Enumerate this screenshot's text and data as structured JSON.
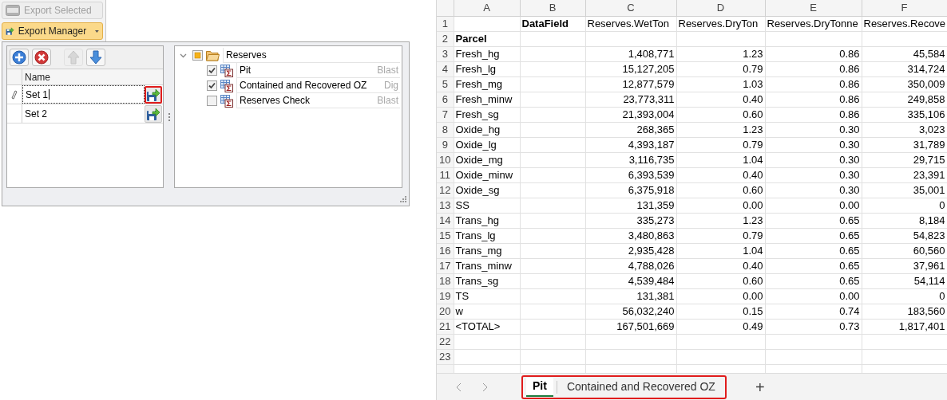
{
  "ribbon": {
    "buttons": [
      {
        "label": "Export Selected",
        "disabled": true,
        "kind": "xlsx",
        "dropdown": false
      },
      {
        "label": "Export Manager",
        "disabled": false,
        "kind": "export",
        "dropdown": true
      }
    ]
  },
  "sets_grid": {
    "toolbar": [
      {
        "kind": "add",
        "disabled": false
      },
      {
        "kind": "delete",
        "disabled": false
      },
      {
        "kind": "up",
        "disabled": true
      },
      {
        "kind": "down",
        "disabled": false
      }
    ],
    "column": "Name",
    "rows": [
      {
        "name": "Set 1",
        "editing": true,
        "highlighted": true
      },
      {
        "name": "Set 2",
        "editing": false,
        "highlighted": false
      }
    ]
  },
  "tree": {
    "label": "Reserves",
    "expanded": true,
    "indeterminate": true,
    "children": [
      {
        "label": "Pit",
        "checked": true,
        "type": "Blast"
      },
      {
        "label": "Contained and Recovered OZ",
        "checked": true,
        "type": "Dig"
      },
      {
        "label": "Reserves Check",
        "checked": false,
        "type": "Blast"
      }
    ]
  },
  "sheet": {
    "columns": [
      "A",
      "B",
      "C",
      "D",
      "E",
      "F"
    ],
    "rows": [
      {
        "number": "1",
        "kind": "header",
        "cells": [
          "",
          "DataField",
          "Reserves.WetTon",
          "Reserves.DryTon",
          "Reserves.DryTonne",
          "Reserves.Recove"
        ]
      },
      {
        "number": "2",
        "kind": "header",
        "cells": [
          "Parcel"
        ]
      },
      {
        "number": "3",
        "kind": "data",
        "cells": [
          "Fresh_hg",
          "",
          "1,408,771",
          "1.23",
          "0.86",
          "45,584"
        ]
      },
      {
        "number": "4",
        "kind": "data",
        "cells": [
          "Fresh_lg",
          "",
          "15,127,205",
          "0.79",
          "0.86",
          "314,724"
        ]
      },
      {
        "number": "5",
        "kind": "data",
        "cells": [
          "Fresh_mg",
          "",
          "12,877,579",
          "1.03",
          "0.86",
          "350,009"
        ]
      },
      {
        "number": "6",
        "kind": "data",
        "cells": [
          "Fresh_minw",
          "",
          "23,773,311",
          "0.40",
          "0.86",
          "249,858"
        ]
      },
      {
        "number": "7",
        "kind": "data",
        "cells": [
          "Fresh_sg",
          "",
          "21,393,004",
          "0.60",
          "0.86",
          "335,106"
        ]
      },
      {
        "number": "8",
        "kind": "data",
        "cells": [
          "Oxide_hg",
          "",
          "268,365",
          "1.23",
          "0.30",
          "3,023"
        ]
      },
      {
        "number": "9",
        "kind": "data",
        "cells": [
          "Oxide_lg",
          "",
          "4,393,187",
          "0.79",
          "0.30",
          "31,789"
        ]
      },
      {
        "number": "10",
        "kind": "data",
        "cells": [
          "Oxide_mg",
          "",
          "3,116,735",
          "1.04",
          "0.30",
          "29,715"
        ]
      },
      {
        "number": "11",
        "kind": "data",
        "cells": [
          "Oxide_minw",
          "",
          "6,393,539",
          "0.40",
          "0.30",
          "23,391"
        ]
      },
      {
        "number": "12",
        "kind": "data",
        "cells": [
          "Oxide_sg",
          "",
          "6,375,918",
          "0.60",
          "0.30",
          "35,001"
        ]
      },
      {
        "number": "13",
        "kind": "data",
        "cells": [
          "SS",
          "",
          "131,359",
          "0.00",
          "0.00",
          "0"
        ]
      },
      {
        "number": "14",
        "kind": "data",
        "cells": [
          "Trans_hg",
          "",
          "335,273",
          "1.23",
          "0.65",
          "8,184"
        ]
      },
      {
        "number": "15",
        "kind": "data",
        "cells": [
          "Trans_lg",
          "",
          "3,480,863",
          "0.79",
          "0.65",
          "54,823"
        ]
      },
      {
        "number": "16",
        "kind": "data",
        "cells": [
          "Trans_mg",
          "",
          "2,935,428",
          "1.04",
          "0.65",
          "60,560"
        ]
      },
      {
        "number": "17",
        "kind": "data",
        "cells": [
          "Trans_minw",
          "",
          "4,788,026",
          "0.40",
          "0.65",
          "37,961"
        ]
      },
      {
        "number": "18",
        "kind": "data",
        "cells": [
          "Trans_sg",
          "",
          "4,539,484",
          "0.60",
          "0.65",
          "54,114"
        ]
      },
      {
        "number": "19",
        "kind": "data",
        "cells": [
          "TS",
          "",
          "131,381",
          "0.00",
          "0.00",
          "0"
        ]
      },
      {
        "number": "20",
        "kind": "data",
        "cells": [
          "w",
          "",
          "56,032,240",
          "0.15",
          "0.74",
          "183,560"
        ]
      },
      {
        "number": "21",
        "kind": "data",
        "cells": [
          "<TOTAL>",
          "",
          "167,501,669",
          "0.49",
          "0.73",
          "1,817,401"
        ]
      },
      {
        "number": "22",
        "cells": []
      },
      {
        "number": "23",
        "cells": []
      }
    ],
    "tabs_highlighted": true,
    "tabs": [
      {
        "label": "Pit",
        "selected": true
      },
      {
        "label": "Contained and Recovered OZ",
        "selected": false
      }
    ],
    "add_tab": "+"
  }
}
